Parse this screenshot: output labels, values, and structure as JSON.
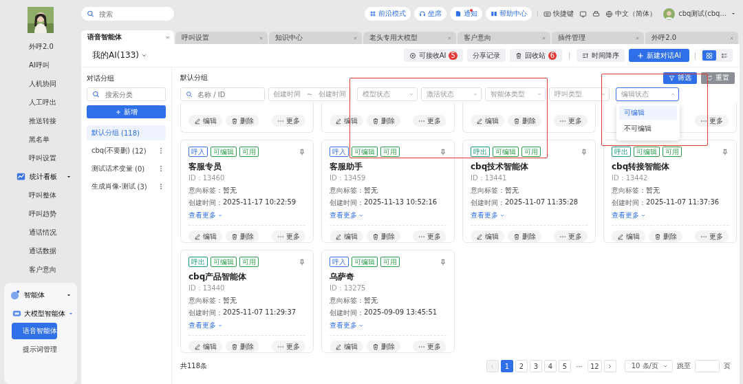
{
  "sidebar": {
    "items": [
      {
        "label": "外呼2.0",
        "kind": "item",
        "selected": false
      },
      {
        "label": "AI呼叫",
        "kind": "item",
        "selected": false
      },
      {
        "label": "人机协同",
        "kind": "item",
        "selected": false
      },
      {
        "label": "人工呼出",
        "kind": "item",
        "selected": false
      },
      {
        "label": "推送转接",
        "kind": "item",
        "selected": false
      },
      {
        "label": "黑名单",
        "kind": "item",
        "selected": false
      },
      {
        "label": "呼叫设置",
        "kind": "item",
        "selected": false
      },
      {
        "label": "统计看板",
        "kind": "section",
        "expanded": true,
        "children": [
          {
            "label": "呼叫整体",
            "kind": "item",
            "selected": false
          },
          {
            "label": "呼叫趋势",
            "kind": "item",
            "selected": false
          },
          {
            "label": "通话情况",
            "kind": "item",
            "selected": false
          },
          {
            "label": "通话数据",
            "kind": "item",
            "selected": false
          },
          {
            "label": "客户意向",
            "kind": "item",
            "selected": false
          }
        ]
      },
      {
        "label": "智能体",
        "kind": "group",
        "expanded": true,
        "children": [
          {
            "label": "大模型智能体",
            "kind": "subsection",
            "expanded": true,
            "children": [
              {
                "label": "语音智能体",
                "kind": "item",
                "selected": true
              },
              {
                "label": "提示词管理",
                "kind": "item",
                "selected": false
              }
            ]
          }
        ]
      }
    ]
  },
  "header": {
    "search": {
      "placeholder": "搜索"
    },
    "buttons": [
      {
        "label": "前沿模式",
        "dot": false
      },
      {
        "label": "坐席",
        "dot": false
      },
      {
        "label": "通知",
        "dot": true
      },
      {
        "label": "帮助中心",
        "dot": false
      }
    ],
    "shortcut": "快捷键",
    "language": "中文（简体）",
    "user": "cbq测试(cbq..."
  },
  "tabs": [
    {
      "label": "语音智能体",
      "selected": true
    },
    {
      "label": "呼叫设置",
      "selected": false
    },
    {
      "label": "知识中心",
      "selected": false
    },
    {
      "label": "老头专用大模型",
      "selected": false
    },
    {
      "label": "客户意向",
      "selected": false
    },
    {
      "label": "插件管理",
      "selected": false
    },
    {
      "label": "外呼2.0",
      "selected": false
    }
  ],
  "toolbar": {
    "title": "我的AI(133)",
    "buttons": [
      {
        "label": "可接收AI",
        "badge": "5",
        "kind": "plain"
      },
      {
        "label": "分享记录",
        "kind": "plain"
      },
      {
        "label": "回收站",
        "badge": "6",
        "kind": "plain"
      },
      {
        "label": "时间降序",
        "kind": "plain"
      },
      {
        "label": "新建对话AI",
        "kind": "primary"
      }
    ],
    "views": [
      {
        "selected": true
      },
      {
        "selected": false
      }
    ]
  },
  "groups": {
    "title": "对话分组",
    "search": {
      "placeholder": "搜索分类"
    },
    "add_button": "新增",
    "items": [
      {
        "name": "默认分组",
        "count": "(118)",
        "selected": true
      },
      {
        "name": "cbq(不要删)",
        "count": "(12)",
        "selected": false
      },
      {
        "name": "测试话术变量",
        "count": "(0)",
        "selected": false
      },
      {
        "name": "生成肖像-测试",
        "count": "(3)",
        "selected": false
      }
    ]
  },
  "content": {
    "title": "默认分组",
    "filter_button": "筛选",
    "reset_button": "重置",
    "filters": [
      {
        "kind": "search",
        "placeholder": "名称 / ID"
      },
      {
        "kind": "daterange",
        "placeholder": "创建时间",
        "placeholder_end": "创建时间",
        "separator": "~"
      },
      {
        "kind": "select",
        "placeholder": "模型状态",
        "expanded": false
      },
      {
        "kind": "select",
        "placeholder": "激活状态",
        "expanded": false
      },
      {
        "kind": "select",
        "placeholder": "智能体类型",
        "expanded": false
      },
      {
        "kind": "select",
        "placeholder": "呼叫类型",
        "expanded": false
      },
      {
        "kind": "select",
        "placeholder": "编辑状态",
        "expanded": true,
        "options": [
          {
            "label": "可编辑",
            "selected": true
          },
          {
            "label": "不可编辑",
            "selected": false
          }
        ]
      }
    ],
    "cards": [
      {
        "kind": "footer",
        "actions": [
          "编辑",
          "删除",
          "更多"
        ]
      },
      {
        "kind": "footer",
        "actions": [
          "编辑",
          "删除",
          "更多"
        ]
      },
      {
        "kind": "footer",
        "actions": [
          "编辑",
          "删除",
          "更多"
        ]
      },
      {
        "kind": "footer",
        "actions": [
          "更多"
        ]
      },
      {
        "kind": "full",
        "tags": [
          {
            "label": "呼入",
            "color": "#3b73e0"
          },
          {
            "label": "可编辑",
            "color": "#2e9b4a"
          },
          {
            "label": "可用",
            "color": "#2e9b4a"
          }
        ],
        "name": "客服专员",
        "id": "ID：13460",
        "intent_label": "意向标签：",
        "intent": "暂无",
        "created_label": "创建时间：",
        "created": "2025-11-17 10:22:59",
        "more_link": "查看更多",
        "actions": [
          "编辑",
          "删除",
          "更多"
        ]
      },
      {
        "kind": "full",
        "tags": [
          {
            "label": "呼入",
            "color": "#3b73e0"
          },
          {
            "label": "可编辑",
            "color": "#2e9b4a"
          },
          {
            "label": "可用",
            "color": "#2e9b4a"
          }
        ],
        "name": "客服助手",
        "id": "ID：13459",
        "intent_label": "意向标签：",
        "intent": "暂无",
        "created_label": "创建时间：",
        "created": "2025-11-13 10:52:16",
        "more_link": "查看更多",
        "actions": [
          "编辑",
          "删除",
          "更多"
        ]
      },
      {
        "kind": "full",
        "tags": [
          {
            "label": "呼出",
            "color": "#1a9a80"
          },
          {
            "label": "可编辑",
            "color": "#2e9b4a"
          },
          {
            "label": "可用",
            "color": "#2e9b4a"
          }
        ],
        "name": "cbq技术智能体",
        "id": "ID：13441",
        "intent_label": "意向标签：",
        "intent": "暂无",
        "created_label": "创建时间：",
        "created": "2025-11-07 11:35:28",
        "more_link": "查看更多",
        "actions": [
          "编辑",
          "删除",
          "更多"
        ]
      },
      {
        "kind": "full",
        "tags": [
          {
            "label": "呼出",
            "color": "#1a9a80"
          },
          {
            "label": "可编辑",
            "color": "#2e9b4a"
          },
          {
            "label": "可用",
            "color": "#2e9b4a"
          }
        ],
        "name": "cbq转接智能体",
        "id": "ID：13442",
        "intent_label": "意向标签：",
        "intent": "暂无",
        "created_label": "创建时间：",
        "created": "2025-11-07 11:37:36",
        "more_link": "查看更多",
        "actions": [
          "编辑",
          "删除",
          "更多"
        ]
      },
      {
        "kind": "full",
        "tags": [
          {
            "label": "呼出",
            "color": "#1a9a80"
          },
          {
            "label": "可编辑",
            "color": "#2e9b4a"
          },
          {
            "label": "可用",
            "color": "#2e9b4a"
          }
        ],
        "name": "cbq产品智能体",
        "id": "ID：13440",
        "intent_label": "意向标签：",
        "intent": "暂无",
        "created_label": "创建时间：",
        "created": "2025-11-07 11:29:37",
        "more_link": "查看更多",
        "actions": [
          "编辑",
          "删除",
          "更多"
        ]
      },
      {
        "kind": "full",
        "tags": [
          {
            "label": "呼入",
            "color": "#3b73e0"
          },
          {
            "label": "可编辑",
            "color": "#2e9b4a"
          },
          {
            "label": "可用",
            "color": "#2e9b4a"
          }
        ],
        "name": "乌萨奇",
        "id": "ID：13275",
        "intent_label": "意向标签：",
        "intent": "暂无",
        "created_label": "创建时间：",
        "created": "2025-09-09 13:45:51",
        "more_link": "查看更多",
        "actions": [
          "编辑",
          "删除",
          "更多"
        ]
      }
    ],
    "pagination": {
      "total": "共118条",
      "pages": [
        {
          "label": "1",
          "selected": true
        },
        {
          "label": "2",
          "selected": false
        },
        {
          "label": "3",
          "selected": false
        },
        {
          "label": "4",
          "selected": false
        },
        {
          "label": "5",
          "selected": false
        },
        {
          "label": "···",
          "selected": false
        },
        {
          "label": "12",
          "selected": false
        }
      ],
      "page_size": "10 条/页",
      "jump_label": "跳至",
      "page_suffix": "页"
    }
  },
  "annotations": [
    {
      "kind": "rect",
      "color": "#e53935"
    },
    {
      "kind": "rect",
      "color": "#e53935"
    }
  ]
}
